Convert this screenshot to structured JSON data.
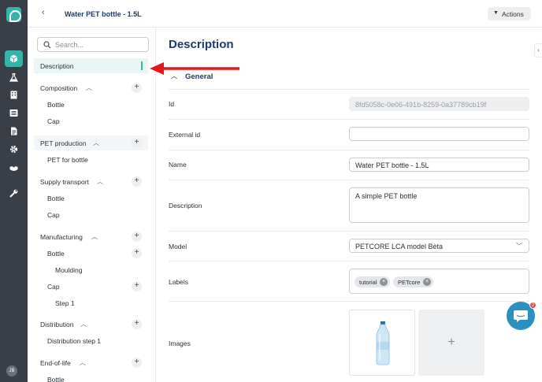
{
  "rail": {
    "icons": [
      "app-logo",
      "cube-icon",
      "flask-icon",
      "factory-icon",
      "list-icon",
      "document-icon",
      "gear-icon",
      "handshake-icon",
      "wrench-icon"
    ],
    "avatar_initials": "JB",
    "accent_color": "#35b5aa"
  },
  "header": {
    "back_label": "‹",
    "breadcrumb": "Water PET bottle - 1.5L",
    "actions_label": "Actions"
  },
  "tree": {
    "search_placeholder": "Search...",
    "selected": "Description",
    "groups": [
      {
        "title": "Composition",
        "children": [
          "Bottle",
          "Cap"
        ]
      },
      {
        "title": "PET production",
        "children": [
          "PET for bottle"
        ]
      },
      {
        "title": "Supply transport",
        "children": [
          "Bottle",
          "Cap"
        ]
      },
      {
        "title": "Manufacturing",
        "children": [
          "Bottle",
          "Moulding",
          "Cap",
          "Step 1"
        ]
      },
      {
        "title": "Distribution",
        "children": [
          "Distribution step 1"
        ]
      },
      {
        "title": "End-of-life",
        "children": [
          "Bottle"
        ]
      }
    ]
  },
  "main": {
    "title": "Description",
    "section": "General",
    "fields": {
      "id_label": "Id",
      "id_value": "8fd5058c-0e06-491b-8259-0a37789cb19f",
      "external_id_label": "External id",
      "external_id_value": "",
      "name_label": "Name",
      "name_value": "Water PET bottle - 1.5L",
      "description_label": "Description",
      "description_value": "A simple PET bottle",
      "model_label": "Model",
      "model_value": "PETCORE LCA model Bèta",
      "labels_label": "Labels",
      "labels": [
        "tutorial",
        "PETcore"
      ],
      "images_label": "Images",
      "add_image": "+"
    }
  },
  "chat": {
    "badge_count": "2"
  }
}
